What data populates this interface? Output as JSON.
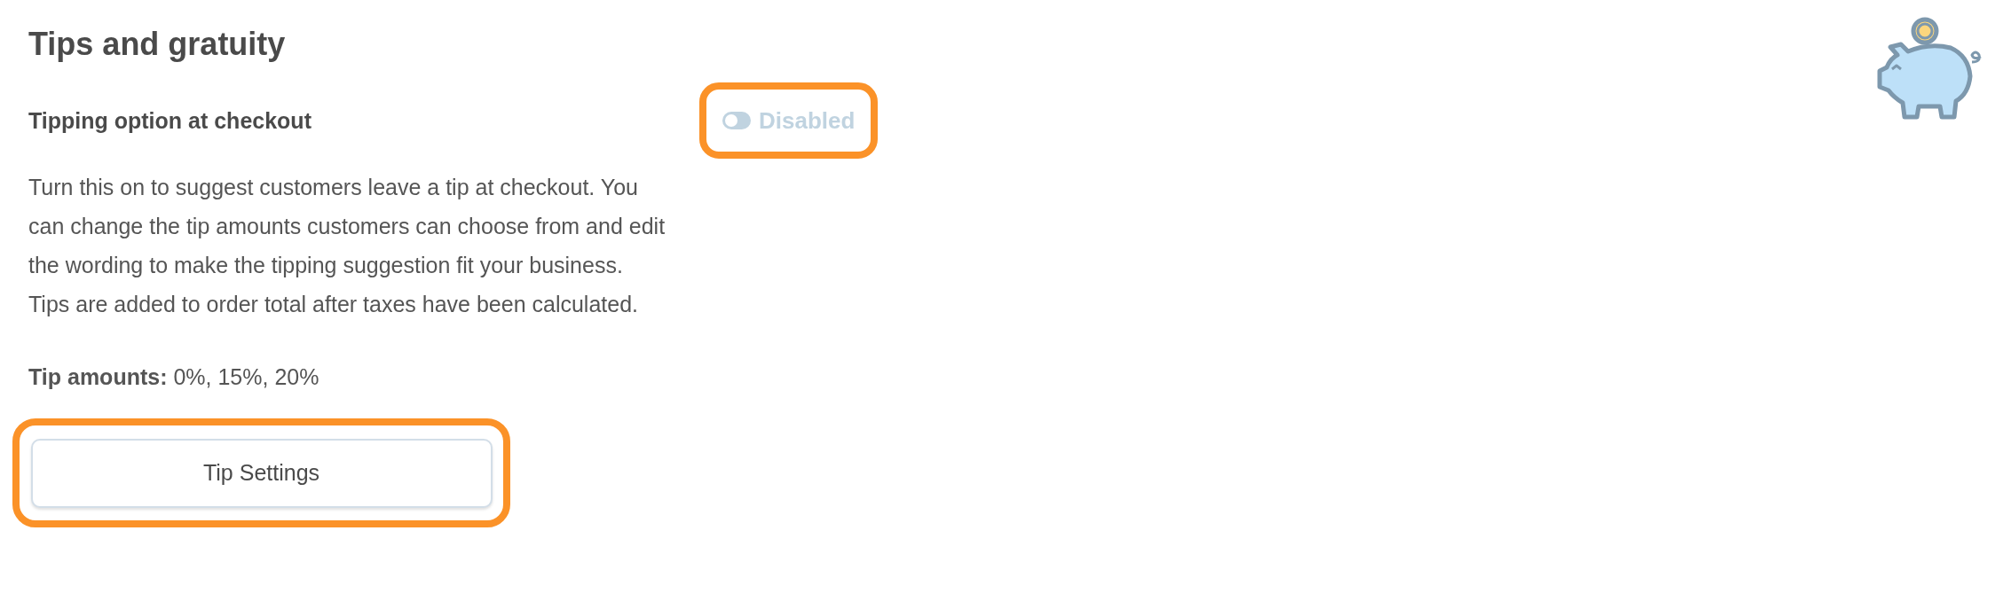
{
  "title": "Tips and gratuity",
  "option": {
    "label": "Tipping option at checkout",
    "toggle": {
      "on": false,
      "label": "Disabled",
      "highlighted": true
    }
  },
  "description": "Turn this on to suggest customers leave a tip at checkout. You can change the tip amounts customers can choose from and edit the wording to make the tipping suggestion fit your business. Tips are added to order total after taxes have been calculated.",
  "tip_amounts": "**Tip amounts:** 0%, 15%, 20%",
  "button": {
    "label": "Tip Settings",
    "highlighted": true
  }
}
